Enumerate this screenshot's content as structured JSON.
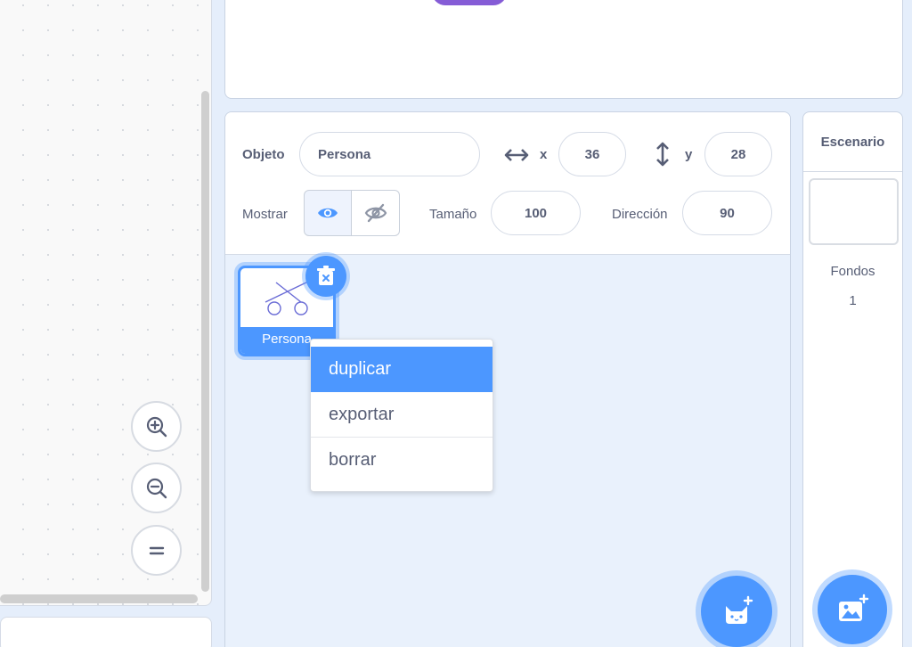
{
  "sprite_info": {
    "sprite_label": "Objeto",
    "sprite_name": "Persona",
    "x_label": "x",
    "x_value": "36",
    "y_label": "y",
    "y_value": "28",
    "show_label": "Mostrar",
    "size_label": "Tamaño",
    "size_value": "100",
    "direction_label": "Dirección",
    "direction_value": "90"
  },
  "sprite_list": {
    "items": [
      {
        "name": "Persona"
      }
    ]
  },
  "context_menu": {
    "items": [
      {
        "label": "duplicar"
      },
      {
        "label": "exportar"
      },
      {
        "label": "borrar"
      }
    ]
  },
  "stage_panel": {
    "title": "Escenario",
    "backdrops_label": "Fondos",
    "backdrops_count": "1"
  },
  "colors": {
    "accent": "#4c97ff",
    "stage_sprite": "#855cd6",
    "text": "#575e75"
  },
  "icons": [
    "zoom-in-icon",
    "zoom-out-icon",
    "zoom-reset-icon",
    "arrows-horizontal-icon",
    "arrows-vertical-icon",
    "eye-icon",
    "eye-off-icon",
    "trash-icon",
    "sprite-add-icon",
    "backdrop-add-icon"
  ]
}
